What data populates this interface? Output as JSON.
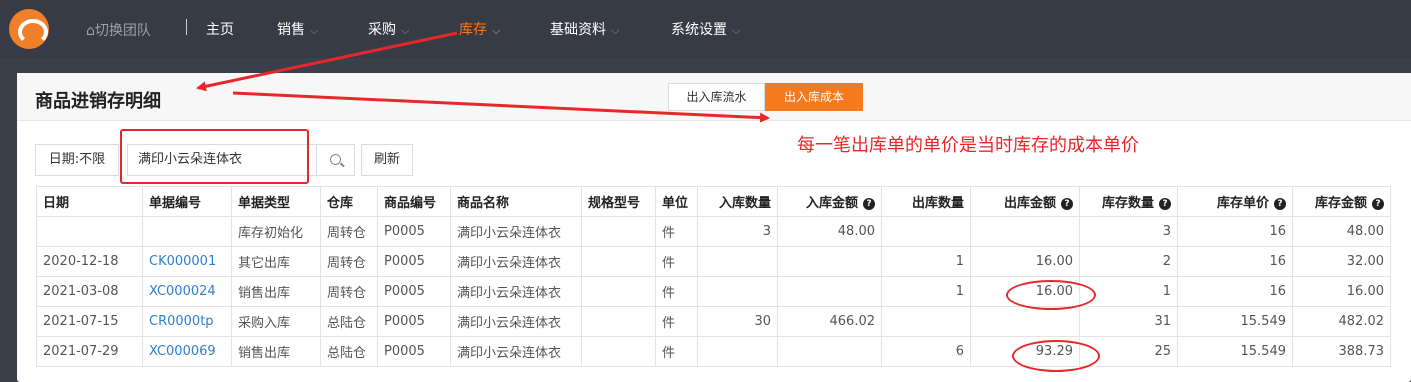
{
  "nav": {
    "team": "⌂切换团队",
    "items": [
      {
        "label": "主页",
        "chevron": ""
      },
      {
        "label": "销售",
        "chevron": "⌵"
      },
      {
        "label": "采购",
        "chevron": "⌵"
      },
      {
        "label": "库存",
        "chevron": "⌵"
      },
      {
        "label": "基础资料",
        "chevron": "⌵"
      },
      {
        "label": "系统设置",
        "chevron": "⌵"
      }
    ],
    "active_color": "#f47a20"
  },
  "header": {
    "title": "商品进销存明细",
    "tabs": [
      "出入库流水",
      "出入库成本"
    ]
  },
  "filter": {
    "date_label": "日期:不限",
    "search_value": "满印小云朵连体衣",
    "refresh_label": "刷新"
  },
  "table": {
    "columns": [
      "日期",
      "单据编号",
      "单据类型",
      "仓库",
      "商品编号",
      "商品名称",
      "规格型号",
      "单位",
      "入库数量",
      "入库金额",
      "出库数量",
      "出库金额",
      "库存数量",
      "库存单价",
      "库存金额"
    ],
    "help_mark": "?",
    "rows": [
      [
        "",
        "",
        "库存初始化",
        "周转仓",
        "P0005",
        "满印小云朵连体衣",
        "",
        "件",
        "3",
        "48.00",
        "",
        "",
        "3",
        "16",
        "48.00"
      ],
      [
        "2020-12-18",
        "CK000001",
        "其它出库",
        "周转仓",
        "P0005",
        "满印小云朵连体衣",
        "",
        "件",
        "",
        "",
        "1",
        "16.00",
        "2",
        "16",
        "32.00"
      ],
      [
        "2021-03-08",
        "XC000024",
        "销售出库",
        "周转仓",
        "P0005",
        "满印小云朵连体衣",
        "",
        "件",
        "",
        "",
        "1",
        "16.00",
        "1",
        "16",
        "16.00"
      ],
      [
        "2021-07-15",
        "CR0000tp",
        "采购入库",
        "总陆仓",
        "P0005",
        "满印小云朵连体衣",
        "",
        "件",
        "30",
        "466.02",
        "",
        "",
        "31",
        "15.549",
        "482.02"
      ],
      [
        "2021-07-29",
        "XC000069",
        "销售出库",
        "总陆仓",
        "P0005",
        "满印小云朵连体衣",
        "",
        "件",
        "",
        "",
        "6",
        "93.29",
        "25",
        "15.549",
        "388.73"
      ]
    ]
  },
  "annotation": {
    "note": "每一笔出库单的单价是当时库存的成本单价",
    "color": "#e8272a"
  }
}
